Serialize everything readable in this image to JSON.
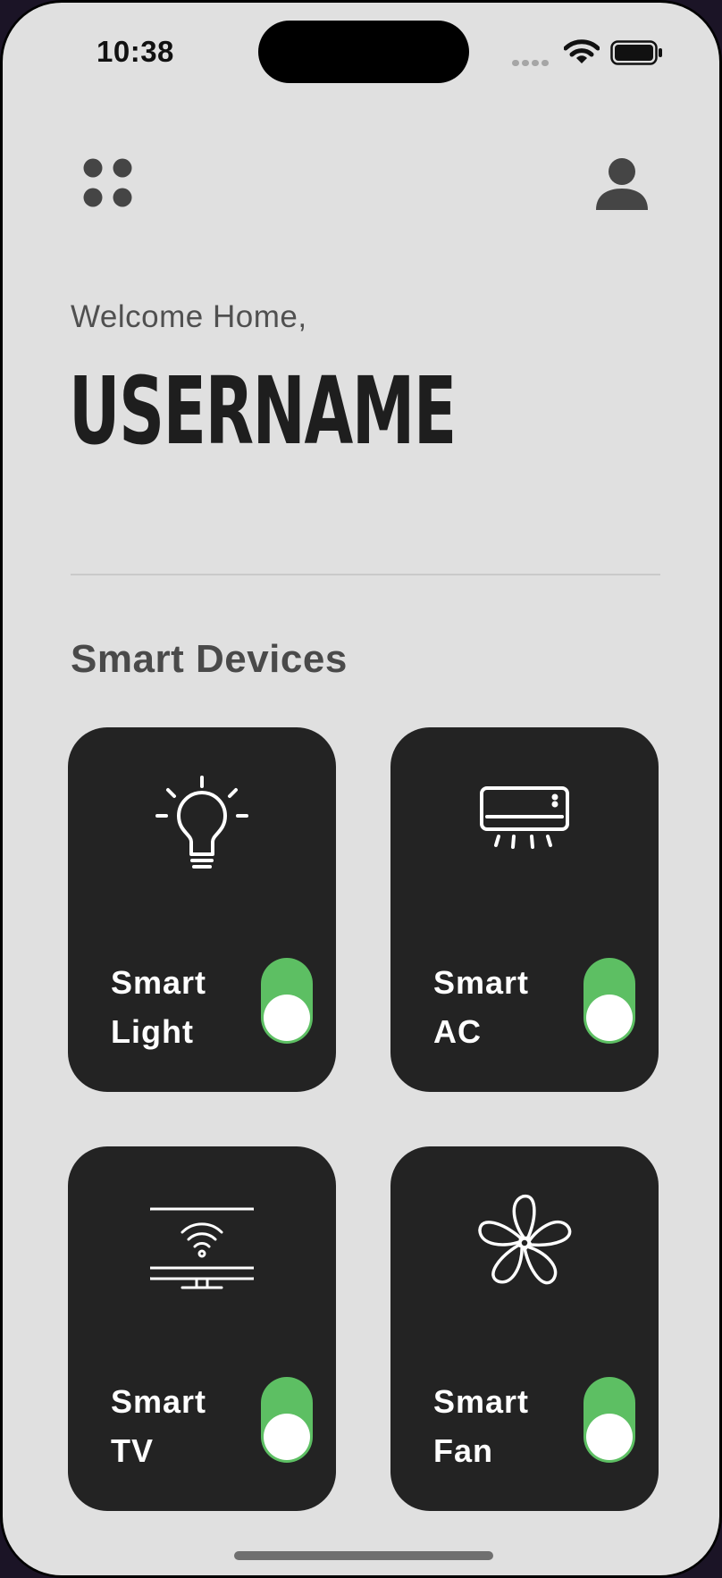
{
  "status_bar": {
    "time": "10:38",
    "icons": [
      "signal-icon",
      "wifi-icon",
      "battery-icon"
    ]
  },
  "header": {
    "menu_icon": "grid-dots-icon",
    "profile_icon": "person-icon"
  },
  "greeting": {
    "welcome": "Welcome Home,",
    "username": "USERNAME"
  },
  "section": {
    "title": "Smart Devices"
  },
  "devices": [
    {
      "line1": "Smart",
      "line2": "Light",
      "icon": "lightbulb-icon",
      "on": true
    },
    {
      "line1": "Smart",
      "line2": "AC",
      "icon": "air-conditioner-icon",
      "on": true
    },
    {
      "line1": "Smart",
      "line2": "TV",
      "icon": "smart-tv-icon",
      "on": true
    },
    {
      "line1": "Smart",
      "line2": "Fan",
      "icon": "fan-icon",
      "on": true
    }
  ],
  "colors": {
    "background": "#e0e0e0",
    "card": "#232323",
    "toggle_on": "#5dbf63",
    "heading": "#1e1e1e"
  }
}
